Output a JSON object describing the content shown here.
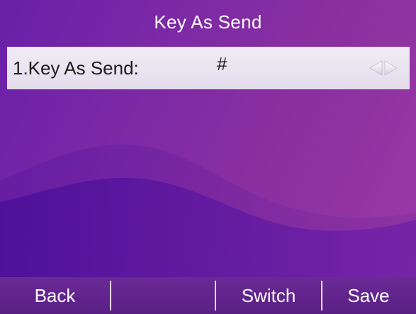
{
  "header": {
    "title": "Key As Send"
  },
  "setting": {
    "label": "1.Key As Send:",
    "value": "#",
    "selector_icon": "left-right-arrows-icon"
  },
  "softkeys": [
    {
      "label": "Back"
    },
    {
      "label": ""
    },
    {
      "label": "Switch"
    },
    {
      "label": "Save"
    }
  ],
  "colors": {
    "background_start": "#6a1fa8",
    "background_end": "#9a3aa6",
    "row_background": "#ece6f2",
    "softkey_bar": "#5f2289",
    "text_light": "#ffffff",
    "text_dark": "#1b1b1b"
  }
}
